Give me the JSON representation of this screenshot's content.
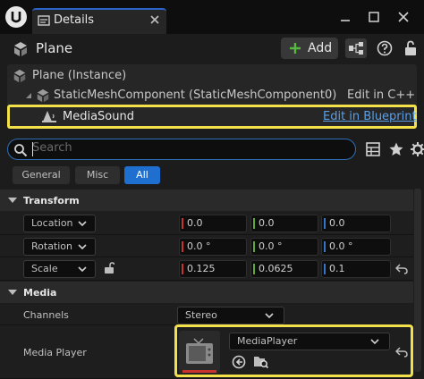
{
  "tab": {
    "label": "Details"
  },
  "header": {
    "title": "Plane",
    "add_label": "Add"
  },
  "tree": {
    "root": "Plane (Instance)",
    "component": "StaticMeshComponent (StaticMeshComponent0)",
    "component_action": "Edit in C++",
    "selected": "MediaSound",
    "selected_action": "Edit in Blueprint"
  },
  "search": {
    "placeholder": "Search"
  },
  "filters": [
    "General",
    "Misc",
    "All"
  ],
  "transform": {
    "title": "Transform",
    "rows": [
      {
        "label": "Location",
        "x": "0.0",
        "y": "0.0",
        "z": "0.0"
      },
      {
        "label": "Rotation",
        "x": "0.0 °",
        "y": "0.0 °",
        "z": "0.0 °"
      },
      {
        "label": "Scale",
        "x": "0.125",
        "y": "0.0625",
        "z": "0.1"
      }
    ]
  },
  "media": {
    "title": "Media",
    "channels_label": "Channels",
    "channels_value": "Stereo",
    "player_label": "Media Player",
    "player_value": "MediaPlayer"
  },
  "colors": {
    "accent": "#2a64c8",
    "highlight": "#f2e14b",
    "link": "#5aa0e8"
  }
}
